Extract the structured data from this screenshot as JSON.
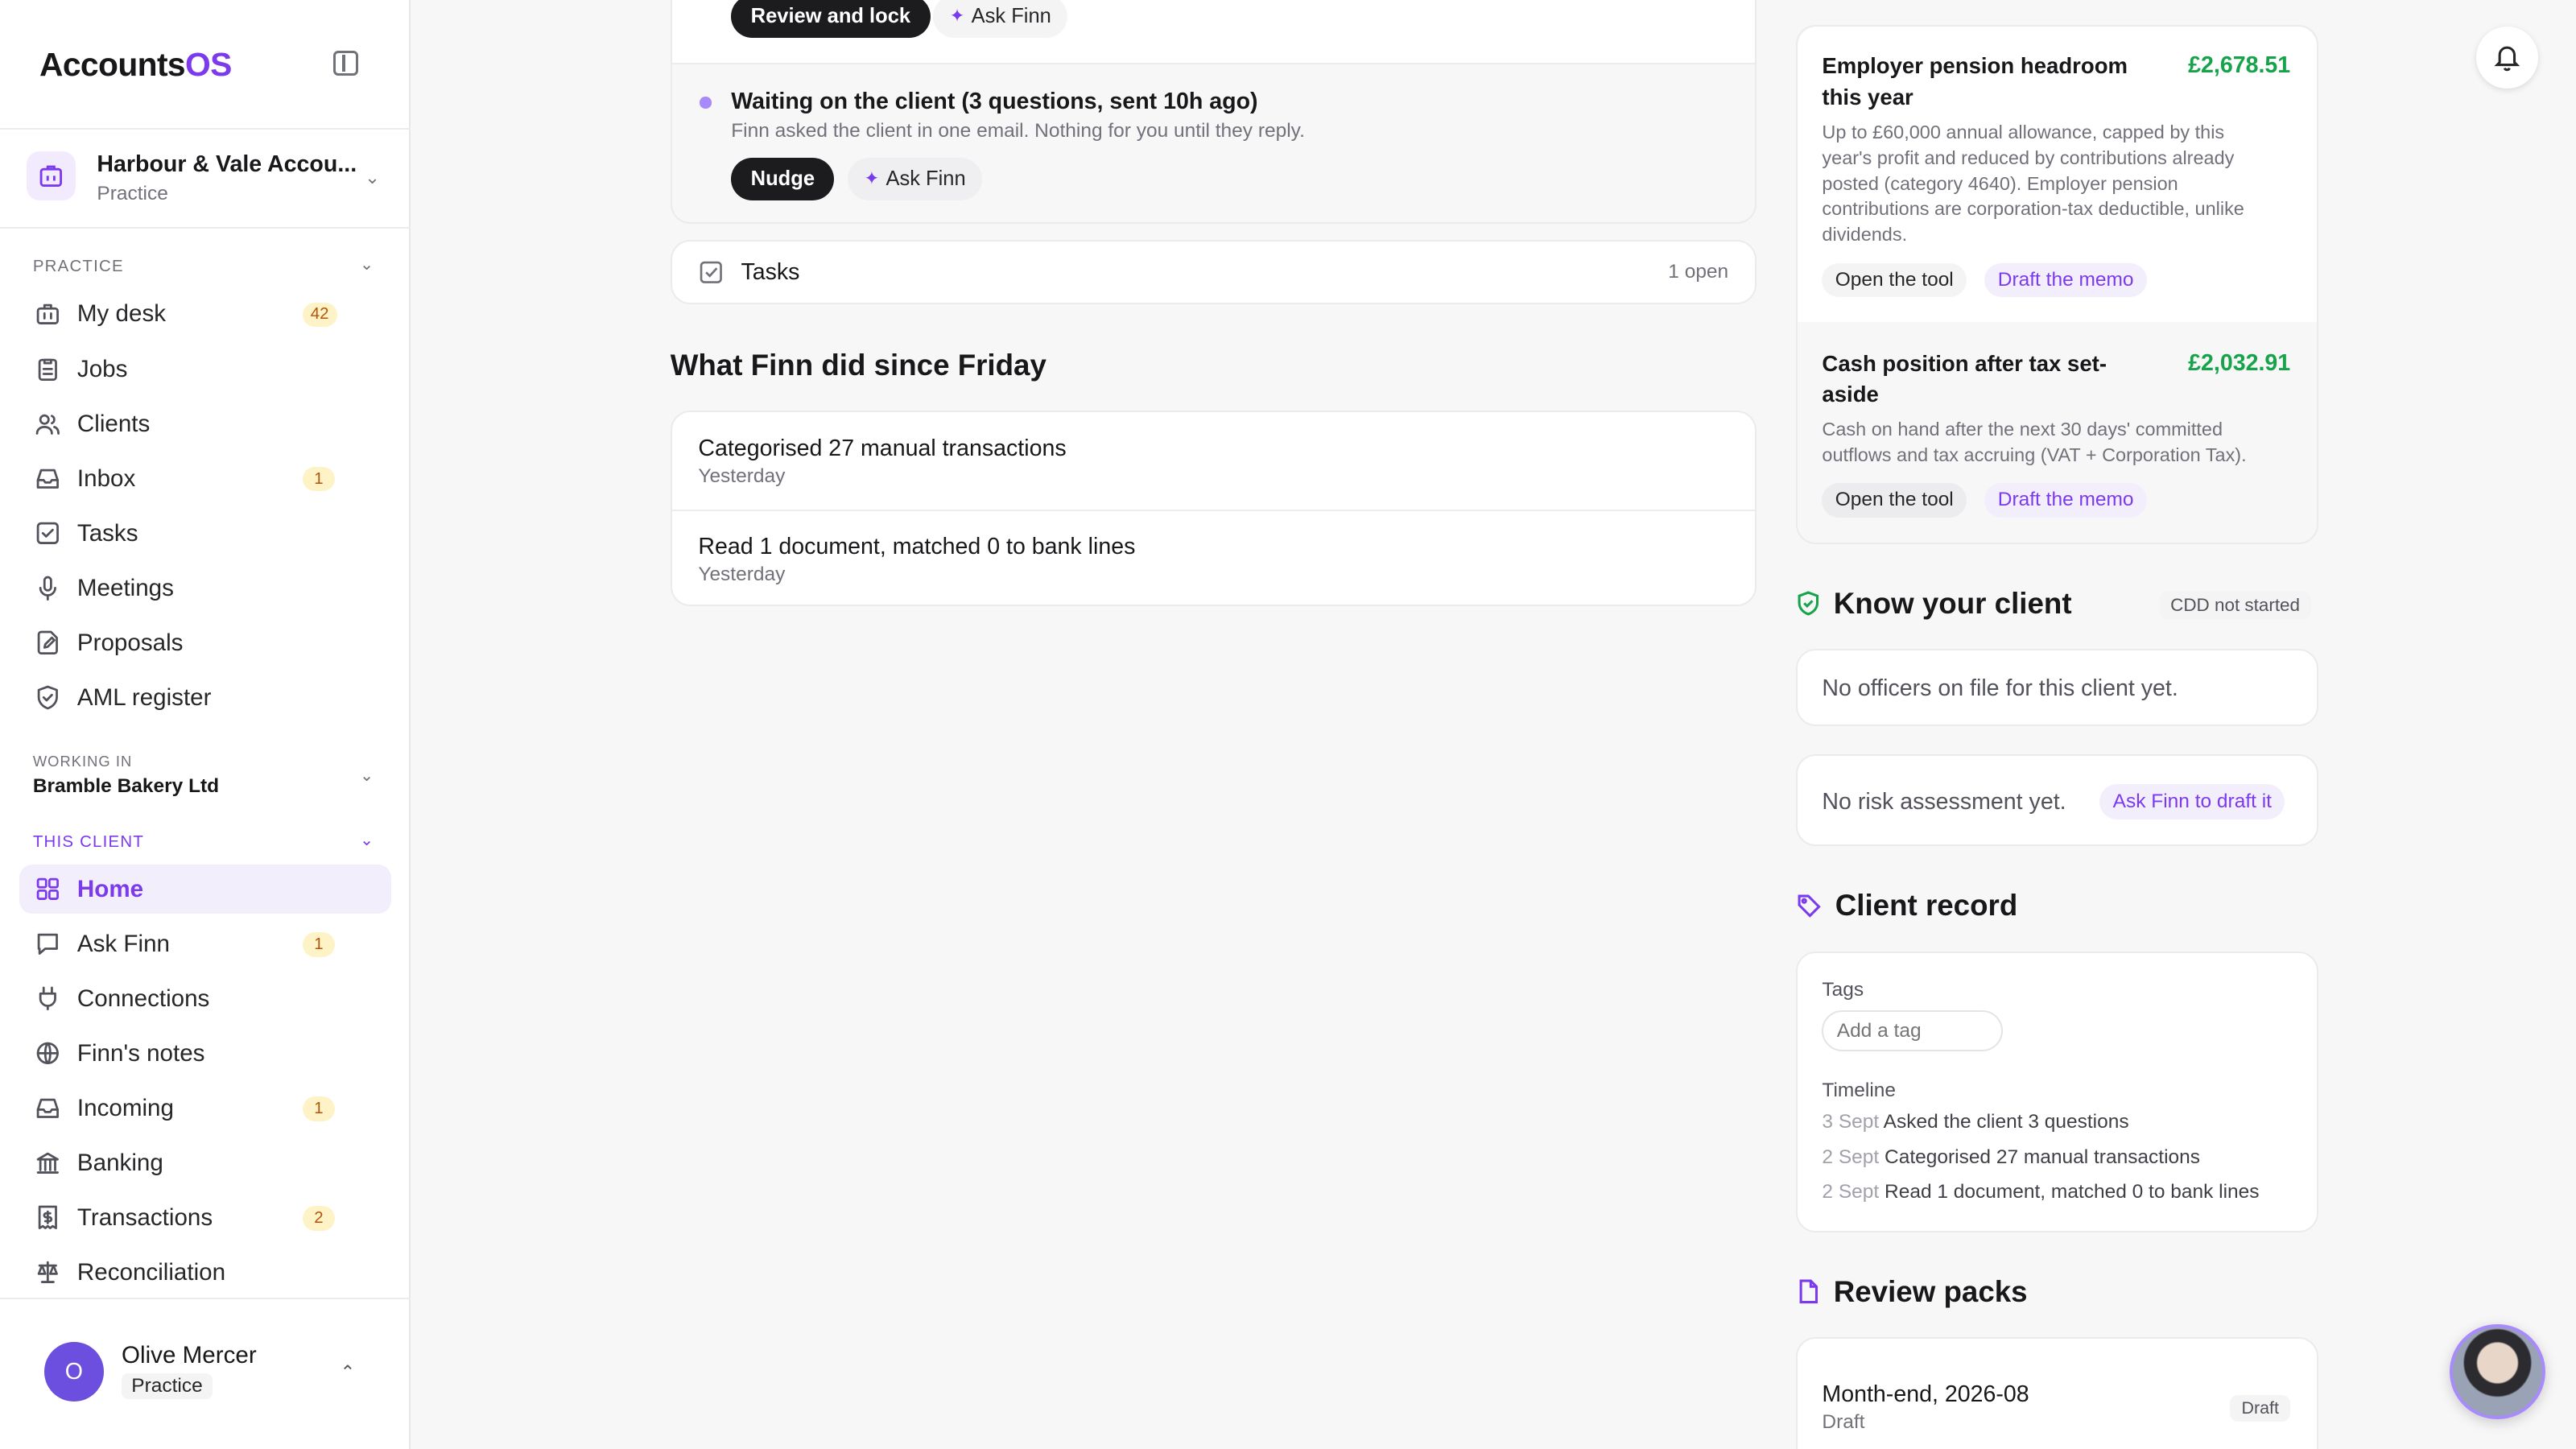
{
  "app": {
    "brand_main": "Accounts",
    "brand_accent": "OS",
    "accent_color": "#7c3aed"
  },
  "org": {
    "name": "Harbour & Vale Accou...",
    "type": "Practice"
  },
  "sidebar": {
    "practice_label": "PRACTICE",
    "practice_items": [
      {
        "label": "My desk",
        "badge": "42",
        "icon": "briefcase-icon"
      },
      {
        "label": "Jobs",
        "badge": "",
        "icon": "clipboard-icon"
      },
      {
        "label": "Clients",
        "badge": "",
        "icon": "users-icon"
      },
      {
        "label": "Inbox",
        "badge": "1",
        "icon": "inbox-icon"
      },
      {
        "label": "Tasks",
        "badge": "",
        "icon": "checkbox-icon"
      },
      {
        "label": "Meetings",
        "badge": "",
        "icon": "microphone-icon"
      },
      {
        "label": "Proposals",
        "badge": "",
        "icon": "file-edit-icon"
      },
      {
        "label": "AML register",
        "badge": "",
        "icon": "shield-icon"
      }
    ],
    "working_in_label": "WORKING IN",
    "working_in_value": "Bramble Bakery Ltd",
    "client_label": "THIS CLIENT",
    "client_items": [
      {
        "label": "Home",
        "badge": "",
        "icon": "grid-icon",
        "active": true
      },
      {
        "label": "Ask Finn",
        "badge": "1",
        "icon": "chat-icon"
      },
      {
        "label": "Connections",
        "badge": "",
        "icon": "plug-icon"
      },
      {
        "label": "Finn's notes",
        "badge": "",
        "icon": "globe-icon"
      },
      {
        "label": "Incoming",
        "badge": "1",
        "icon": "inbox-icon"
      },
      {
        "label": "Banking",
        "badge": "",
        "icon": "bank-icon"
      },
      {
        "label": "Transactions",
        "badge": "2",
        "icon": "receipt-icon"
      },
      {
        "label": "Reconciliation",
        "badge": "",
        "icon": "scale-icon"
      }
    ]
  },
  "user": {
    "initial": "O",
    "name": "Olive Mercer",
    "role": "Practice"
  },
  "main": {
    "top_card": {
      "review_button": "Review and lock",
      "ask_finn_button": "Ask Finn",
      "waiting_title": "Waiting on the client (3 questions, sent 10h ago)",
      "waiting_desc": "Finn asked the client in one email. Nothing for you until they reply.",
      "nudge_button": "Nudge",
      "ask_finn_button_2": "Ask Finn"
    },
    "tasks": {
      "label": "Tasks",
      "count": "1 open"
    },
    "finn_section_title": "What Finn did since Friday",
    "finn_items": [
      {
        "title": "Categorised 27 manual transactions",
        "when": "Yesterday"
      },
      {
        "title": "Read 1 document, matched 0 to bank lines",
        "when": "Yesterday"
      }
    ]
  },
  "right": {
    "insights": [
      {
        "title_line1": "Employer pension headroom",
        "title_line2": "this year",
        "amount": "£2,678.51",
        "desc_lines": [
          "Up to £60,000 annual allowance, capped by this",
          "year's profit and reduced by contributions already",
          "posted (category 4640). Employer pension",
          "contributions are corporation-tax deductible, unlike",
          "dividends."
        ],
        "open_tool": "Open the tool",
        "draft_memo": "Draft the memo"
      },
      {
        "title_line1": "Cash position after tax set-",
        "title_line2": "aside",
        "amount": "£2,032.91",
        "desc_lines": [
          "Cash on hand after the next 30 days' committed",
          "outflows and tax accruing (VAT + Corporation Tax)."
        ],
        "open_tool": "Open the tool",
        "draft_memo": "Draft the memo"
      }
    ],
    "kyc": {
      "title": "Know your client",
      "status": "CDD not started",
      "officers_text": "No officers on file for this client yet.",
      "risk_text": "No risk assessment yet.",
      "risk_button": "Ask Finn to draft it"
    },
    "client_record": {
      "title": "Client record",
      "tags_label": "Tags",
      "tag_placeholder": "Add a tag",
      "timeline_label": "Timeline",
      "timeline": [
        {
          "date": "3 Sept",
          "text": "Asked the client 3 questions"
        },
        {
          "date": "2 Sept",
          "text": "Categorised 27 manual transactions"
        },
        {
          "date": "2 Sept",
          "text": "Read 1 document, matched 0 to bank lines"
        }
      ]
    },
    "review_packs": {
      "title": "Review packs",
      "items": [
        {
          "name": "Month-end, 2026-08",
          "status": "Draft",
          "badge": "Draft"
        }
      ]
    }
  }
}
